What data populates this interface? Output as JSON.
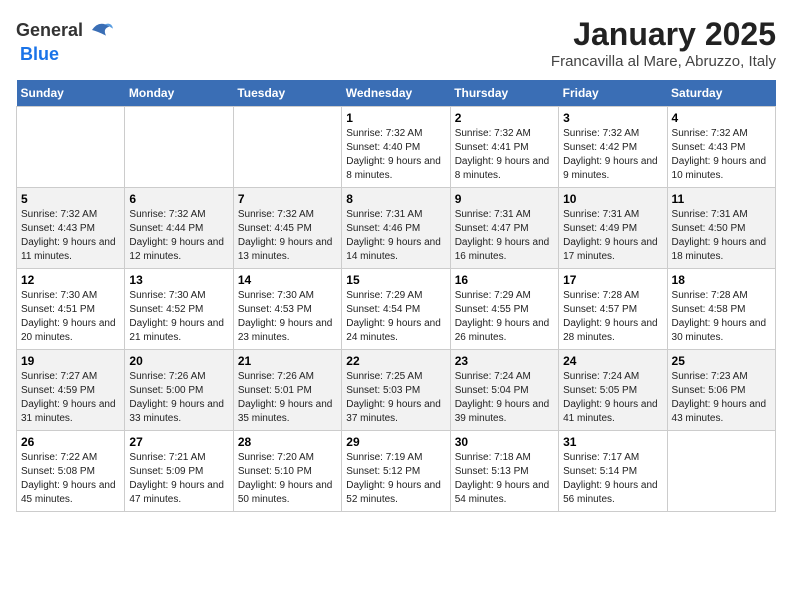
{
  "header": {
    "logo_general": "General",
    "logo_blue": "Blue",
    "title": "January 2025",
    "subtitle": "Francavilla al Mare, Abruzzo, Italy"
  },
  "days_of_week": [
    "Sunday",
    "Monday",
    "Tuesday",
    "Wednesday",
    "Thursday",
    "Friday",
    "Saturday"
  ],
  "weeks": [
    [
      {
        "day": "",
        "info": ""
      },
      {
        "day": "",
        "info": ""
      },
      {
        "day": "",
        "info": ""
      },
      {
        "day": "1",
        "info": "Sunrise: 7:32 AM\nSunset: 4:40 PM\nDaylight: 9 hours and 8 minutes."
      },
      {
        "day": "2",
        "info": "Sunrise: 7:32 AM\nSunset: 4:41 PM\nDaylight: 9 hours and 8 minutes."
      },
      {
        "day": "3",
        "info": "Sunrise: 7:32 AM\nSunset: 4:42 PM\nDaylight: 9 hours and 9 minutes."
      },
      {
        "day": "4",
        "info": "Sunrise: 7:32 AM\nSunset: 4:43 PM\nDaylight: 9 hours and 10 minutes."
      }
    ],
    [
      {
        "day": "5",
        "info": "Sunrise: 7:32 AM\nSunset: 4:43 PM\nDaylight: 9 hours and 11 minutes."
      },
      {
        "day": "6",
        "info": "Sunrise: 7:32 AM\nSunset: 4:44 PM\nDaylight: 9 hours and 12 minutes."
      },
      {
        "day": "7",
        "info": "Sunrise: 7:32 AM\nSunset: 4:45 PM\nDaylight: 9 hours and 13 minutes."
      },
      {
        "day": "8",
        "info": "Sunrise: 7:31 AM\nSunset: 4:46 PM\nDaylight: 9 hours and 14 minutes."
      },
      {
        "day": "9",
        "info": "Sunrise: 7:31 AM\nSunset: 4:47 PM\nDaylight: 9 hours and 16 minutes."
      },
      {
        "day": "10",
        "info": "Sunrise: 7:31 AM\nSunset: 4:49 PM\nDaylight: 9 hours and 17 minutes."
      },
      {
        "day": "11",
        "info": "Sunrise: 7:31 AM\nSunset: 4:50 PM\nDaylight: 9 hours and 18 minutes."
      }
    ],
    [
      {
        "day": "12",
        "info": "Sunrise: 7:30 AM\nSunset: 4:51 PM\nDaylight: 9 hours and 20 minutes."
      },
      {
        "day": "13",
        "info": "Sunrise: 7:30 AM\nSunset: 4:52 PM\nDaylight: 9 hours and 21 minutes."
      },
      {
        "day": "14",
        "info": "Sunrise: 7:30 AM\nSunset: 4:53 PM\nDaylight: 9 hours and 23 minutes."
      },
      {
        "day": "15",
        "info": "Sunrise: 7:29 AM\nSunset: 4:54 PM\nDaylight: 9 hours and 24 minutes."
      },
      {
        "day": "16",
        "info": "Sunrise: 7:29 AM\nSunset: 4:55 PM\nDaylight: 9 hours and 26 minutes."
      },
      {
        "day": "17",
        "info": "Sunrise: 7:28 AM\nSunset: 4:57 PM\nDaylight: 9 hours and 28 minutes."
      },
      {
        "day": "18",
        "info": "Sunrise: 7:28 AM\nSunset: 4:58 PM\nDaylight: 9 hours and 30 minutes."
      }
    ],
    [
      {
        "day": "19",
        "info": "Sunrise: 7:27 AM\nSunset: 4:59 PM\nDaylight: 9 hours and 31 minutes."
      },
      {
        "day": "20",
        "info": "Sunrise: 7:26 AM\nSunset: 5:00 PM\nDaylight: 9 hours and 33 minutes."
      },
      {
        "day": "21",
        "info": "Sunrise: 7:26 AM\nSunset: 5:01 PM\nDaylight: 9 hours and 35 minutes."
      },
      {
        "day": "22",
        "info": "Sunrise: 7:25 AM\nSunset: 5:03 PM\nDaylight: 9 hours and 37 minutes."
      },
      {
        "day": "23",
        "info": "Sunrise: 7:24 AM\nSunset: 5:04 PM\nDaylight: 9 hours and 39 minutes."
      },
      {
        "day": "24",
        "info": "Sunrise: 7:24 AM\nSunset: 5:05 PM\nDaylight: 9 hours and 41 minutes."
      },
      {
        "day": "25",
        "info": "Sunrise: 7:23 AM\nSunset: 5:06 PM\nDaylight: 9 hours and 43 minutes."
      }
    ],
    [
      {
        "day": "26",
        "info": "Sunrise: 7:22 AM\nSunset: 5:08 PM\nDaylight: 9 hours and 45 minutes."
      },
      {
        "day": "27",
        "info": "Sunrise: 7:21 AM\nSunset: 5:09 PM\nDaylight: 9 hours and 47 minutes."
      },
      {
        "day": "28",
        "info": "Sunrise: 7:20 AM\nSunset: 5:10 PM\nDaylight: 9 hours and 50 minutes."
      },
      {
        "day": "29",
        "info": "Sunrise: 7:19 AM\nSunset: 5:12 PM\nDaylight: 9 hours and 52 minutes."
      },
      {
        "day": "30",
        "info": "Sunrise: 7:18 AM\nSunset: 5:13 PM\nDaylight: 9 hours and 54 minutes."
      },
      {
        "day": "31",
        "info": "Sunrise: 7:17 AM\nSunset: 5:14 PM\nDaylight: 9 hours and 56 minutes."
      },
      {
        "day": "",
        "info": ""
      }
    ]
  ]
}
